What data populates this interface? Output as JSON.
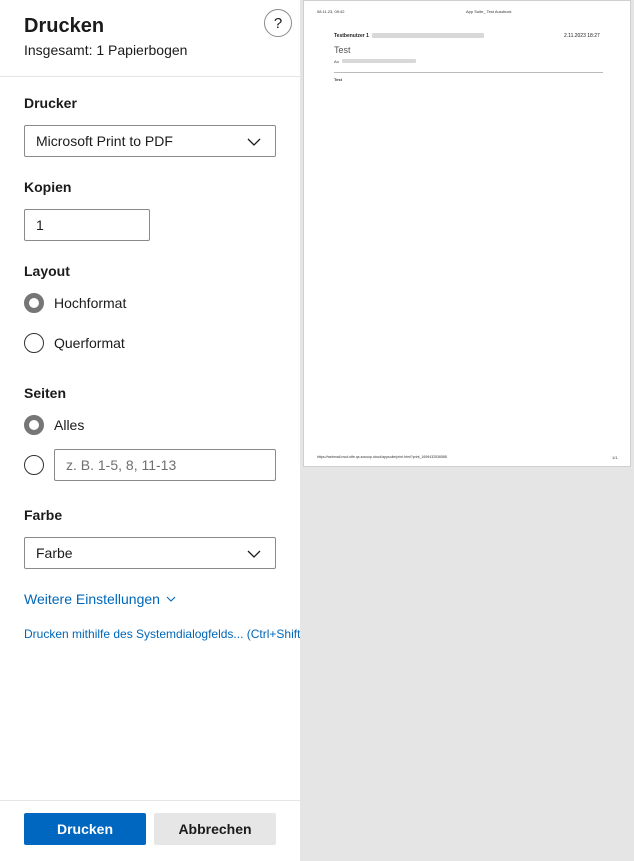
{
  "dialog": {
    "title": "Drucken",
    "subtitle": "Insgesamt: 1 Papierbogen",
    "help_symbol": "?"
  },
  "printer": {
    "label": "Drucker",
    "selected": "Microsoft Print to PDF"
  },
  "copies": {
    "label": "Kopien",
    "value": "1"
  },
  "layout": {
    "label": "Layout",
    "options": [
      {
        "label": "Hochformat",
        "checked": true
      },
      {
        "label": "Querformat",
        "checked": false
      }
    ]
  },
  "pages": {
    "label": "Seiten",
    "all_label": "Alles",
    "range_placeholder": "z. B. 1-5, 8, 11-13"
  },
  "color": {
    "label": "Farbe",
    "selected": "Farbe"
  },
  "links": {
    "more_settings": "Weitere Einstellungen",
    "system_dialog": "Drucken mithilfe des Systemdialogfelds... (Ctrl+Shift"
  },
  "buttons": {
    "print": "Drucken",
    "cancel": "Abbrechen"
  },
  "preview": {
    "header_left": "08.11.23, 09:42",
    "header_center": "App Suite_ Test Ausdruck",
    "sender": "Testbenutzer 1",
    "date": "2.11.2023 18:27",
    "subject": "Test",
    "to_label": "An",
    "body": "Test",
    "footer_url": "https://webmail-mod.stfe.qs.sousop.cloud/appsuite/print.html?print_1699432536588",
    "page_number": "1/1"
  },
  "colors": {
    "accent": "#0067c0",
    "link": "#0067b8",
    "preview_background": "#e5e5e5"
  }
}
